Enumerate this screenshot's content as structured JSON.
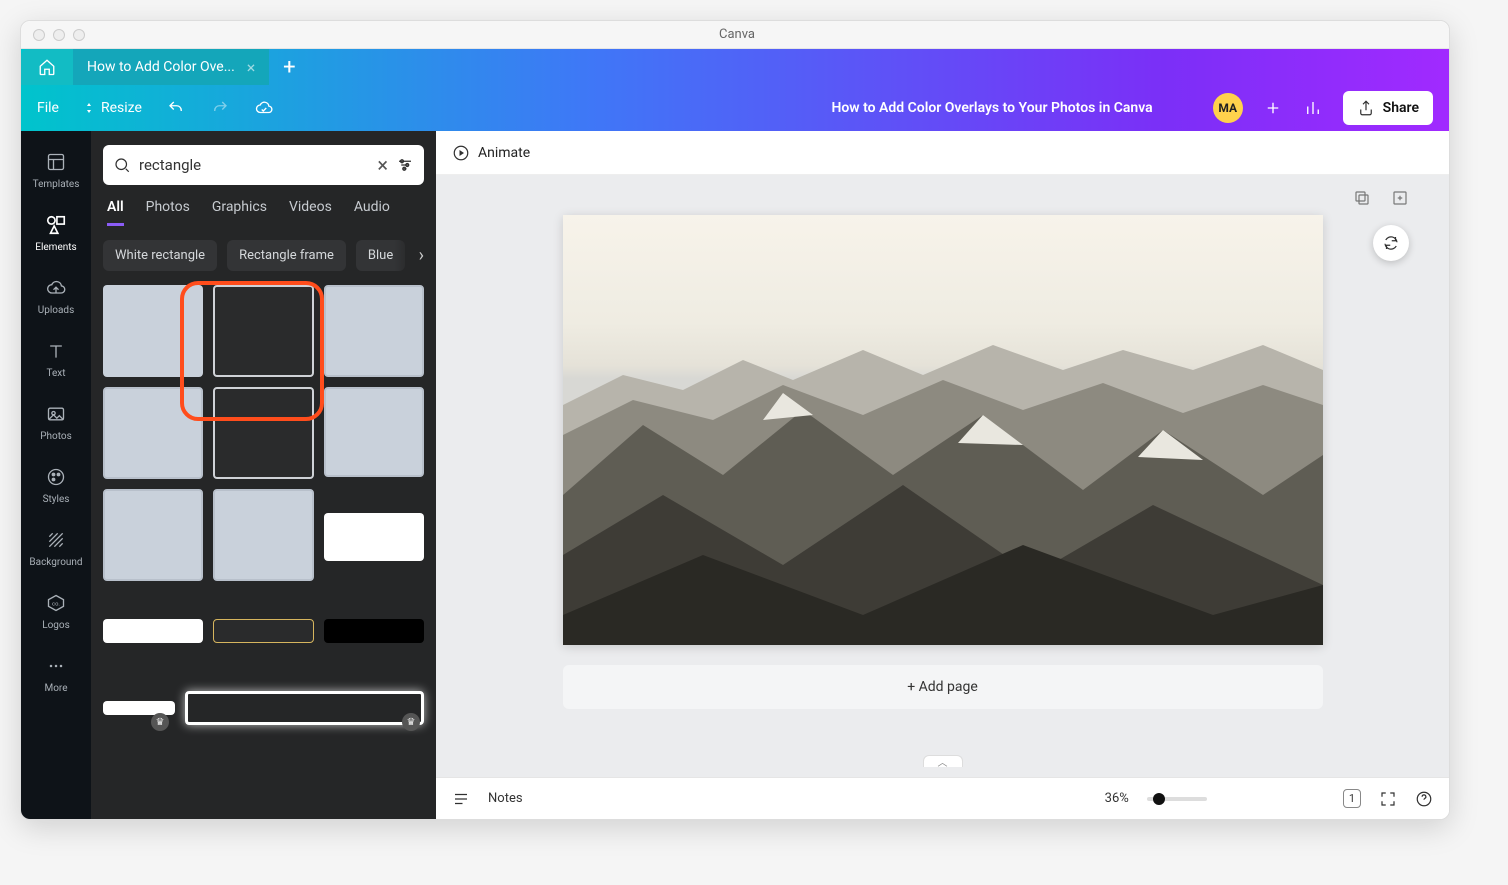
{
  "window": {
    "title": "Canva"
  },
  "tabs": {
    "current": "How to Add Color Ove..."
  },
  "toolbar": {
    "file": "File",
    "resize": "Resize",
    "doc_title": "How to Add Color Overlays to Your Photos in Canva",
    "avatar_initials": "MA",
    "share": "Share"
  },
  "rail": {
    "templates": "Templates",
    "elements": "Elements",
    "uploads": "Uploads",
    "text": "Text",
    "photos": "Photos",
    "styles": "Styles",
    "background": "Background",
    "logos": "Logos",
    "more": "More"
  },
  "panel": {
    "search_value": "rectangle",
    "tabs": {
      "all": "All",
      "photos": "Photos",
      "graphics": "Graphics",
      "videos": "Videos",
      "audio": "Audio"
    },
    "chips": {
      "white": "White rectangle",
      "frame": "Rectangle frame",
      "blue": "Blue"
    }
  },
  "canvas": {
    "animate": "Animate",
    "add_page": "+ Add page"
  },
  "footer": {
    "notes": "Notes",
    "zoom": "36%",
    "page_count": "1"
  }
}
